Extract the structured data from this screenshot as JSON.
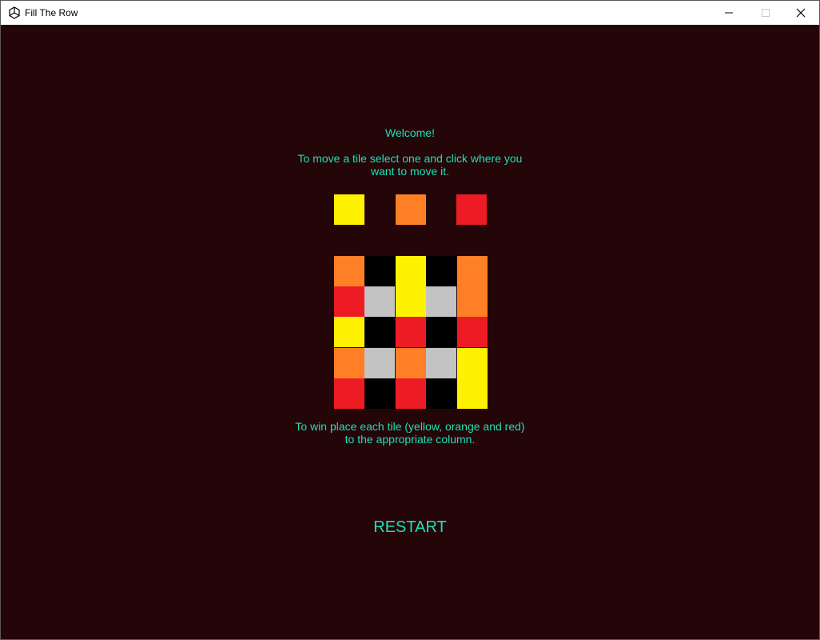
{
  "window": {
    "title": "Fill The Row"
  },
  "text": {
    "welcome": "Welcome!",
    "instructions": "To move a tile select one and click where you want to move it.",
    "win_condition": "To win place each tile (yellow, orange and red) to the appropriate column.",
    "restart": "RESTART"
  },
  "colors": {
    "background": "#240508",
    "text": "#1de0b8",
    "yellow": "#fff200",
    "orange": "#ff7f27",
    "red": "#ed1c24",
    "black": "#000000",
    "gray": "#c3c3c3"
  },
  "targets": [
    "yellow",
    "orange",
    "red"
  ],
  "grid": [
    [
      "orange",
      "black",
      "yellow",
      "black",
      "orange"
    ],
    [
      "red",
      "gray",
      "yellow",
      "gray",
      "orange"
    ],
    [
      "yellow",
      "black",
      "red",
      "black",
      "red"
    ],
    [
      "orange",
      "gray",
      "orange",
      "gray",
      "yellow"
    ],
    [
      "red",
      "black",
      "red",
      "black",
      "yellow"
    ]
  ]
}
